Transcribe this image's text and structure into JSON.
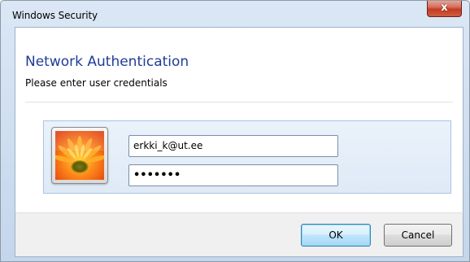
{
  "window": {
    "title": "Windows Security",
    "close_glyph": "x"
  },
  "header": {
    "title": "Network Authentication",
    "subtitle": "Please enter user credentials"
  },
  "credentials": {
    "avatar_icon": "user-tile-flower-icon",
    "username_value": "erkki_k@ut.ee",
    "password_masked": "•••••••"
  },
  "buttons": {
    "ok_label": "OK",
    "cancel_label": "Cancel"
  },
  "colors": {
    "header_title": "#1f3d97",
    "close_button": "#c23b25",
    "panel_border": "#a9c4e3",
    "default_button_border": "#3c7fb1"
  }
}
